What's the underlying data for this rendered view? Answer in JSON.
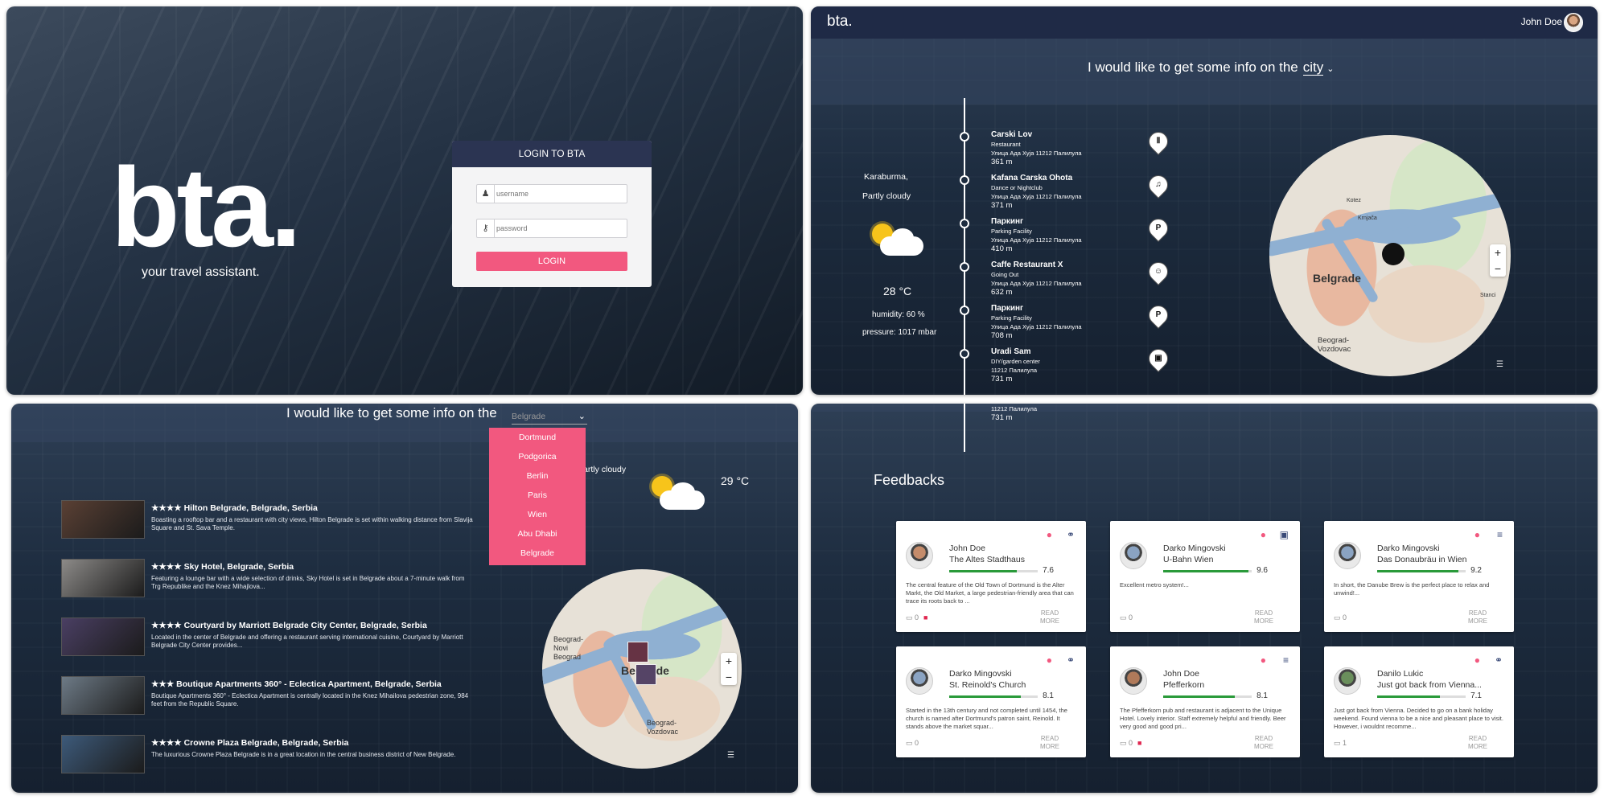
{
  "login_panel": {
    "logo": "bta.",
    "tagline": "your travel assistant.",
    "box_title": "LOGIN TO BTA",
    "username_placeholder": "username",
    "password_placeholder": "password",
    "login_button": "LOGIN"
  },
  "city_panel": {
    "brand": "bta.",
    "user_name": "John Doe",
    "prompt": "I would like to get some info on the",
    "city_link": "city",
    "weather": {
      "location": "Karaburma,",
      "condition": "Partly cloudy",
      "temperature": "28 °C",
      "humidity": "humidity: 60 %",
      "pressure": "pressure: 1017 mbar"
    },
    "places": [
      {
        "name": "Carski Lov",
        "type": "Restaurant",
        "address": "Улица Ада Хуја 11212 Палилула",
        "distance": "361 m",
        "icon": "cutlery-icon",
        "glyph": "Ⅱ"
      },
      {
        "name": "Kafana Carska Ohota",
        "type": "Dance or Nightclub",
        "address": "Улица Ада Хуја 11212 Палилула",
        "distance": "371 m",
        "icon": "nightclub-icon",
        "glyph": "♫"
      },
      {
        "name": "Паркинг",
        "type": "Parking Facility",
        "address": "Улица Ада Хуја 11212 Палилула",
        "distance": "410 m",
        "icon": "parking-icon",
        "glyph": "P"
      },
      {
        "name": "Caffe Restaurant X",
        "type": "Going Out",
        "address": "Улица Ада Хуја 11212 Палилула",
        "distance": "632 m",
        "icon": "mask-icon",
        "glyph": "☺"
      },
      {
        "name": "Паркинг",
        "type": "Parking Facility",
        "address": "Улица Ада Хуја 11212 Палилула",
        "distance": "708 m",
        "icon": "parking-icon",
        "glyph": "P"
      },
      {
        "name": "Uradi Sam",
        "type": "DIY/garden center",
        "address": "11212 Палилула",
        "distance": "731 m",
        "icon": "bag-icon",
        "glyph": "▣"
      }
    ],
    "map_labels": {
      "city": "Belgrade",
      "district": "Beograd-Vozdovac",
      "kotez": "Kotez",
      "krnjaca": "Krnjača",
      "stanci": "Stanci"
    }
  },
  "hotels_panel": {
    "prompt": "I would like to get some info on the",
    "select_value": "Belgrade",
    "dropdown_options": [
      "Dortmund",
      "Podgorica",
      "Berlin",
      "Paris",
      "Wien",
      "Abu Dhabi",
      "Belgrade"
    ],
    "weather_condition": "artly cloudy",
    "temperature": "29 °C",
    "hotels": [
      {
        "title": "★★★★ Hilton Belgrade, Belgrade, Serbia",
        "desc": "Boasting a rooftop bar and a restaurant with city views, Hilton Belgrade is set within walking distance from Slavija Square and St. Sava Temple."
      },
      {
        "title": "★★★★ Sky Hotel, Belgrade, Serbia",
        "desc": "Featuring a lounge bar with a wide selection of drinks, Sky Hotel is set in Belgrade about a 7-minute walk from Trg Republike and the Knez Mihajlova..."
      },
      {
        "title": "★★★★ Courtyard by Marriott Belgrade City Center, Belgrade, Serbia",
        "desc": "Located in the center of Belgrade and offering a restaurant serving international cuisine, Courtyard by Marriott Belgrade City Center provides..."
      },
      {
        "title": "★★★ Boutique Apartments 360° - Eclectica Apartment, Belgrade, Serbia",
        "desc": "Boutique Apartments 360° - Eclectica Apartment is centrally located in the Knez Mihailova pedestrian zone, 984 feet from the Republic Square."
      },
      {
        "title": "★★★★ Crowne Plaza Belgrade, Belgrade, Serbia",
        "desc": "The luxurious Crowne Plaza Belgrade is in a great location in the central business district of New Belgrade."
      }
    ],
    "map_labels": {
      "city": "Belgrade",
      "novi": "Beograd-Novi Beograd",
      "district": "Beograd-Vozdovac"
    }
  },
  "feedback_panel": {
    "title": "Feedbacks",
    "partial_address": "11212 Палилула",
    "partial_distance": "731 m",
    "read_more": "READ MORE",
    "cards": [
      {
        "user": "John Doe",
        "place": "The Altes Stadthaus",
        "score": "7.6",
        "score_fraction": 0.76,
        "text": "The central feature of the Old Town of Dortmund is the Alter Markt, the Old Market, a large pedestrian-friendly area that can trace its roots back to ...",
        "comments": "0",
        "trash": true,
        "cat": "binoculars-icon",
        "cat_glyph": "⚭"
      },
      {
        "user": "Darko Mingovski",
        "place": "U-Bahn Wien",
        "score": "9.6",
        "score_fraction": 0.96,
        "text": "Excellent metro system!...",
        "comments": "0",
        "trash": false,
        "cat": "bus-icon",
        "cat_glyph": "▣"
      },
      {
        "user": "Darko Mingovski",
        "place": "Das Donaubräu in Wien",
        "score": "9.2",
        "score_fraction": 0.92,
        "text": "In short, the Danube Brew is the perfect place to relax and unwind!...",
        "comments": "0",
        "trash": false,
        "cat": "burger-icon",
        "cat_glyph": "≡"
      },
      {
        "user": "Darko Mingovski",
        "place": "St. Reinold's Church",
        "score": "8.1",
        "score_fraction": 0.81,
        "text": "Started in the 13th century and not completed until 1454, the church is named after Dortmund's patron saint, Reinold. It stands above the market squar...",
        "comments": "0",
        "trash": false,
        "cat": "binoculars-icon",
        "cat_glyph": "⚭"
      },
      {
        "user": "John Doe",
        "place": "Pfefferkorn",
        "score": "8.1",
        "score_fraction": 0.81,
        "text": "The Pfefferkorn pub and restaurant is adjacent to the Unique Hotel. Lovely interior. Staff extremely helpful and friendly. Beer very good and good pri...",
        "comments": "0",
        "trash": true,
        "cat": "burger-icon",
        "cat_glyph": "≡"
      },
      {
        "user": "Danilo Lukic",
        "place": "Just got back from Vienna...",
        "score": "7.1",
        "score_fraction": 0.71,
        "text": "Just got back from Vienna. Decided to go on a bank holiday weekend. Found vienna to be a nice and pleasant place to visit. However, i wouldnt recomme...",
        "comments": "1",
        "trash": false,
        "cat": "binoculars-icon",
        "cat_glyph": "⚭"
      }
    ]
  },
  "colors": {
    "accent": "#f2587f",
    "navy": "#1f2a46",
    "score_bar": "#2a9a3a"
  }
}
